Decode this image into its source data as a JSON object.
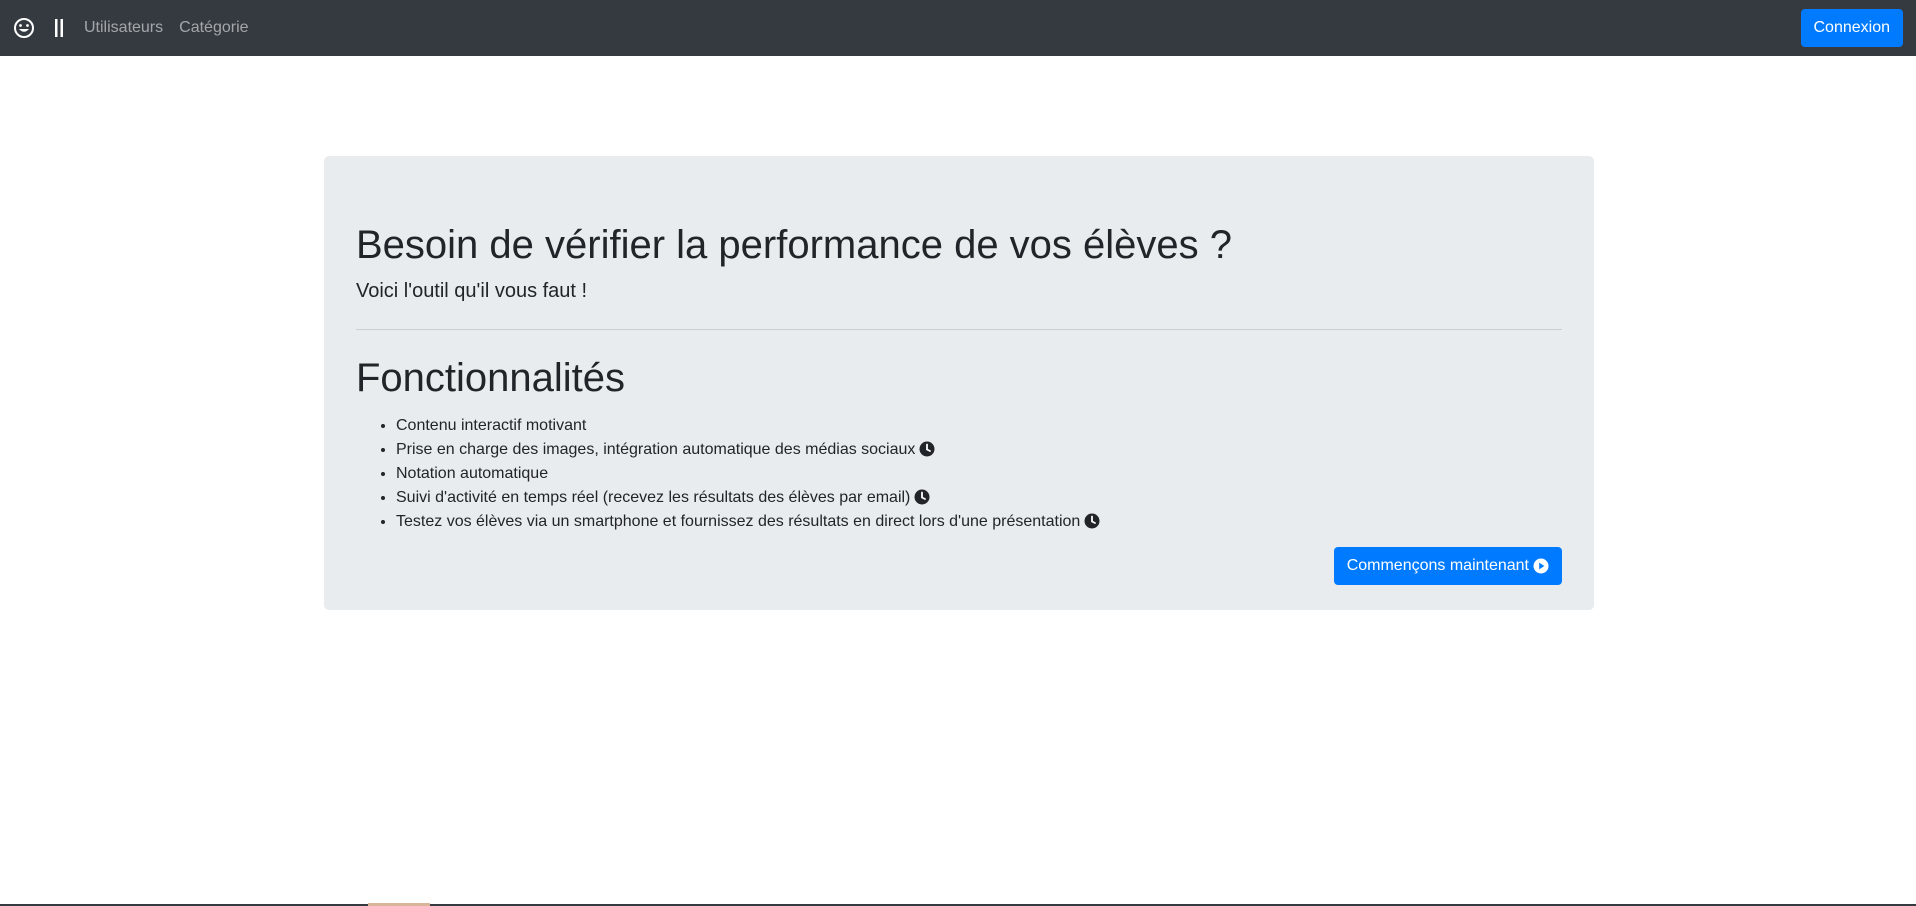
{
  "navbar": {
    "brand_icon": "smiley-icon",
    "separator_icon": "double-bar-icon",
    "links": [
      {
        "label": "Utilisateurs"
      },
      {
        "label": "Catégorie"
      }
    ],
    "login_label": "Connexion"
  },
  "jumbotron": {
    "title": "Besoin de vérifier la performance de vos élèves ?",
    "lead": "Voici l'outil qu'il vous faut !",
    "features_title": "Fonctionnalités",
    "features": [
      {
        "text": "Contenu interactif motivant",
        "icon": ""
      },
      {
        "text": "Prise en charge des images, intégration automatique des médias sociaux",
        "icon": "clock-icon"
      },
      {
        "text": "Notation automatique",
        "icon": ""
      },
      {
        "text": "Suivi d'activité en temps réel (recevez les résultats des élèves par email)",
        "icon": "clock-icon"
      },
      {
        "text": "Testez vos élèves via un smartphone et fournissez des résultats en direct lors d'une présentation",
        "icon": "clock-icon"
      }
    ],
    "cta_label": "Commençons maintenant",
    "cta_icon": "play-circle-icon"
  },
  "colors": {
    "navbar_bg": "#343a40",
    "primary": "#007bff",
    "jumbotron_bg": "#e9ecef"
  }
}
